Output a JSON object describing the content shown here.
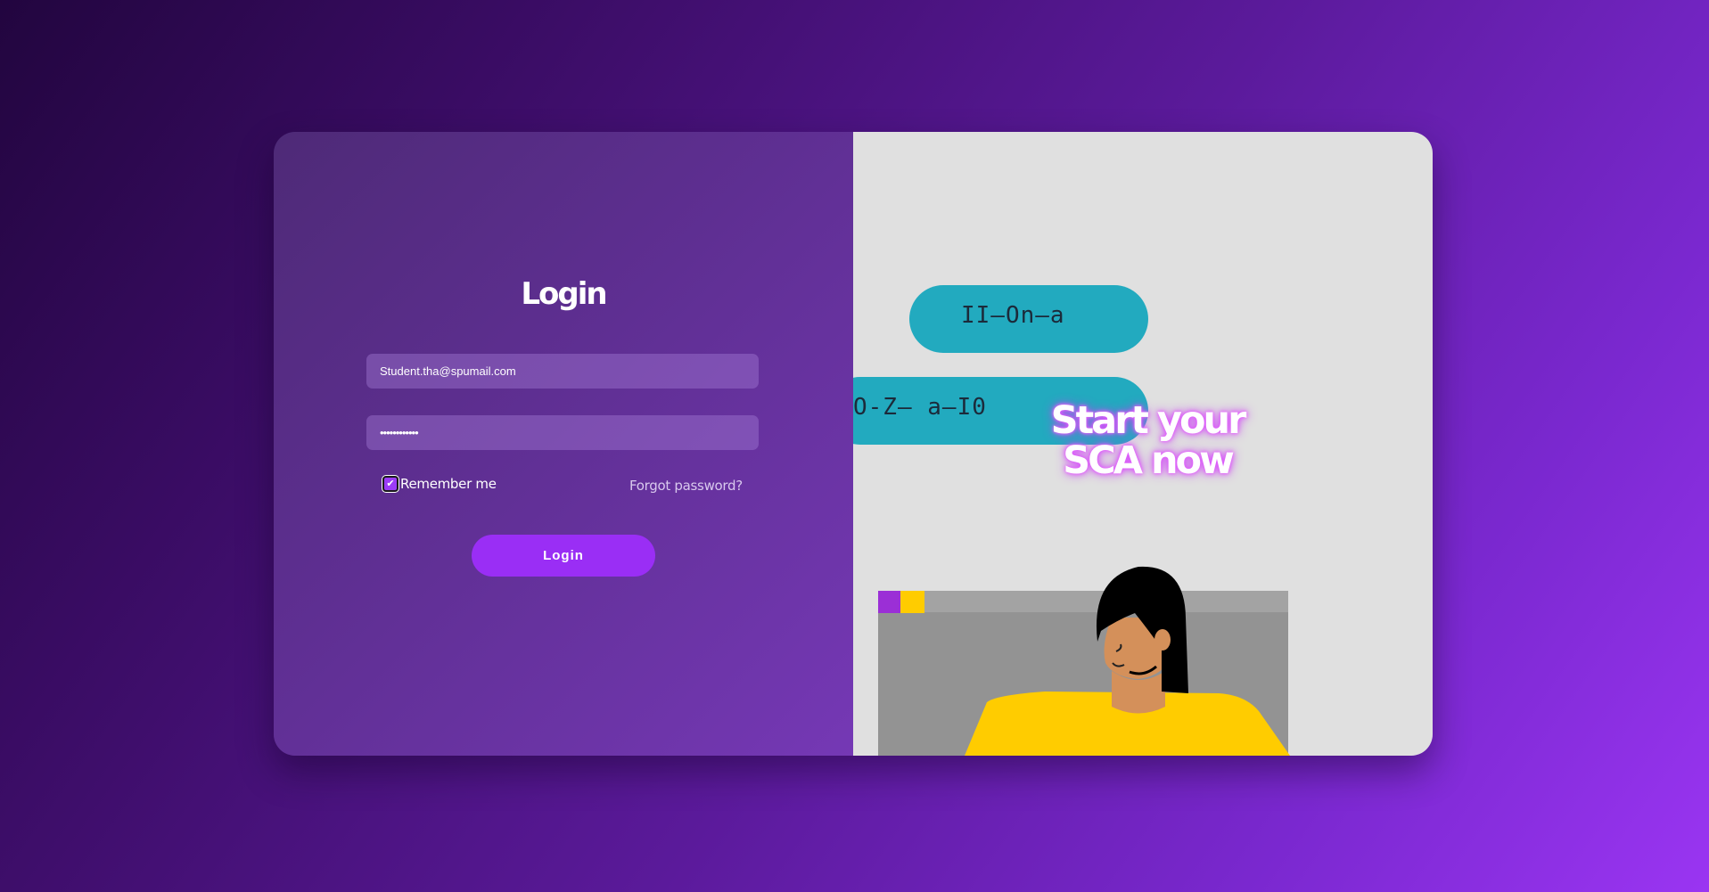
{
  "login_panel": {
    "title": "Login",
    "email_value": "Student.tha@spumail.com",
    "password_value": "••••••••••••",
    "remember_label": "Remember me",
    "remember_checked": true,
    "forgot_label": "Forgot password?",
    "login_button_label": "Login"
  },
  "promo_panel": {
    "headline": "Start your SCA now",
    "pill_one_glyphs": "II—On—a",
    "pill_two_glyphs": "O-Z—  a—I0"
  },
  "icons": {
    "checkbox": "checkmark-icon"
  },
  "colors": {
    "accent": "#9a2ef5",
    "pill": "#22aabf",
    "panel_right_bg": "#e0e0e0"
  }
}
